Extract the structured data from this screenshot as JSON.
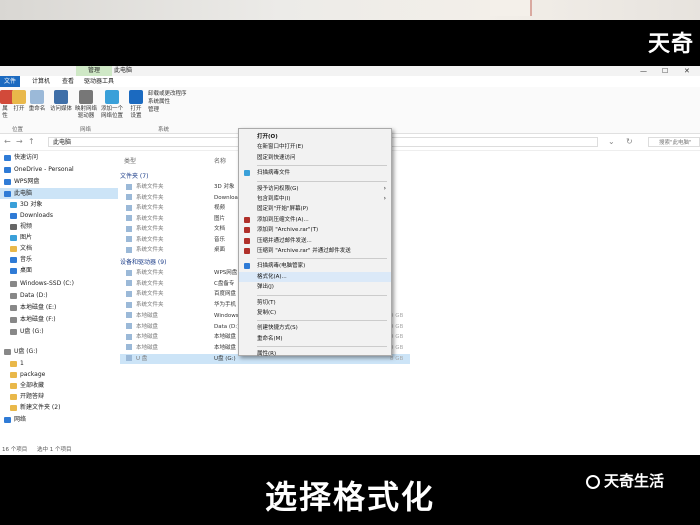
{
  "watermark_top": "天奇",
  "watermark_bottom": "天奇生活",
  "caption": "选择格式化",
  "window": {
    "context_tab": "管理",
    "title": "此电脑",
    "controls": [
      "—",
      "☐",
      "✕"
    ],
    "ribbon_tabs": [
      "文件",
      "计算机",
      "查看",
      "驱动器工具"
    ],
    "ribbon_buttons": [
      {
        "label": "属性"
      },
      {
        "label": "打开"
      },
      {
        "label": "重命名"
      },
      {
        "label": "访问媒体"
      },
      {
        "label": "映射网络驱动器"
      },
      {
        "label": "添加一个网络位置"
      },
      {
        "label": "打开设置"
      }
    ],
    "ribbon_small": [
      "卸载或更改程序",
      "系统属性",
      "管理"
    ],
    "groups": [
      "位置",
      "网络",
      "系统"
    ],
    "address": "此电脑",
    "search_placeholder": "搜索\"此电脑\""
  },
  "nav": [
    {
      "label": "快速访问",
      "color": "#2f7bd6"
    },
    {
      "label": "OneDrive - Personal",
      "color": "#2f7bd6"
    },
    {
      "label": "WPS网盘",
      "color": "#2f7bd6"
    },
    {
      "label": "此电脑",
      "color": "#2f7bd6"
    },
    {
      "label": "3D 对象",
      "color": "#3aa0d9"
    },
    {
      "label": "Downloads",
      "color": "#2f7bd6"
    },
    {
      "label": "视频",
      "color": "#666"
    },
    {
      "label": "图片",
      "color": "#3aa0d9"
    },
    {
      "label": "文档",
      "color": "#e9b84a"
    },
    {
      "label": "音乐",
      "color": "#2f7bd6"
    },
    {
      "label": "桌面",
      "color": "#2f7bd6"
    },
    {
      "label": "Windows-SSD (C:)",
      "color": "#888"
    },
    {
      "label": "Data (D:)",
      "color": "#888"
    },
    {
      "label": "本地磁盘 (E:)",
      "color": "#888"
    },
    {
      "label": "本地磁盘 (F:)",
      "color": "#888"
    },
    {
      "label": "U盘 (G:)",
      "color": "#888"
    },
    {
      "label": "U盘 (G:)",
      "color": "#888"
    },
    {
      "label": "1",
      "color": "#e9b84a"
    },
    {
      "label": "package",
      "color": "#e9b84a"
    },
    {
      "label": "全部收藏",
      "color": "#e9b84a"
    },
    {
      "label": "开题答辩",
      "color": "#e9b84a"
    },
    {
      "label": "新建文件夹 (2)",
      "color": "#e9b84a"
    },
    {
      "label": "网络",
      "color": "#2f7bd6"
    }
  ],
  "columns": {
    "type": "类型",
    "name": "名称"
  },
  "groups": {
    "folders": "文件夹 (7)",
    "devices": "设备和驱动器 (9)"
  },
  "folder_rows": [
    {
      "type": "系统文件夹",
      "name": "3D 对象"
    },
    {
      "type": "系统文件夹",
      "name": "Download"
    },
    {
      "type": "系统文件夹",
      "name": "视频"
    },
    {
      "type": "系统文件夹",
      "name": "图片"
    },
    {
      "type": "系统文件夹",
      "name": "文档"
    },
    {
      "type": "系统文件夹",
      "name": "音乐"
    },
    {
      "type": "系统文件夹",
      "name": "桌面"
    }
  ],
  "device_rows": [
    {
      "type": "系统文件夹",
      "name": "WPS网盘",
      "size": ""
    },
    {
      "type": "系统文件夹",
      "name": "C盘备专",
      "size": ""
    },
    {
      "type": "系统文件夹",
      "name": "百度网盘",
      "size": ""
    },
    {
      "type": "系统文件夹",
      "name": "华为手机",
      "size": ""
    },
    {
      "type": "本地磁盘",
      "name": "Windows",
      "size": "9 GB"
    },
    {
      "type": "本地磁盘",
      "name": "Data (D:)",
      "size": "9 GB"
    },
    {
      "type": "本地磁盘",
      "name": "本地磁盘",
      "size": "9 GB"
    },
    {
      "type": "本地磁盘",
      "name": "本地磁盘",
      "size": "9 GB"
    },
    {
      "type": "U 盘",
      "name": "U盘 (G:)",
      "size": "8 GB"
    }
  ],
  "status": {
    "count": "16 个项目",
    "selected": "选中 1 个项目"
  },
  "menu": [
    {
      "label": "打开(O)",
      "bold": true,
      "icon": ""
    },
    {
      "label": "在新窗口中打开(E)",
      "icon": ""
    },
    {
      "label": "固定到快速访问",
      "icon": ""
    },
    {
      "sep": true
    },
    {
      "label": "扫描病毒文件",
      "icon": "#3aa0d9"
    },
    {
      "sep": true
    },
    {
      "label": "授予访问权限(G)",
      "arrow": true,
      "icon": ""
    },
    {
      "label": "包含到库中(I)",
      "arrow": true,
      "icon": ""
    },
    {
      "label": "固定到\"开始\"屏幕(P)",
      "icon": ""
    },
    {
      "label": "添加到压缩文件(A)...",
      "icon": "#b0302a"
    },
    {
      "label": "添加到 \"Archive.rar\"(T)",
      "icon": "#b0302a"
    },
    {
      "label": "压缩并通过邮件发送...",
      "icon": "#b0302a"
    },
    {
      "label": "压缩到 \"Archive.rar\" 并通过邮件发送",
      "icon": "#b0302a"
    },
    {
      "sep": true
    },
    {
      "label": "扫描病毒(电脑管家)",
      "icon": "#2f7bd6"
    },
    {
      "label": "格式化(A)...",
      "icon": "",
      "highlight": true
    },
    {
      "label": "弹出(J)",
      "icon": ""
    },
    {
      "sep": true
    },
    {
      "label": "剪切(T)",
      "icon": ""
    },
    {
      "label": "复制(C)",
      "icon": ""
    },
    {
      "sep": true
    },
    {
      "label": "创建快捷方式(S)",
      "icon": ""
    },
    {
      "label": "重命名(M)",
      "icon": ""
    },
    {
      "sep": true
    },
    {
      "label": "属性(R)",
      "icon": ""
    }
  ]
}
